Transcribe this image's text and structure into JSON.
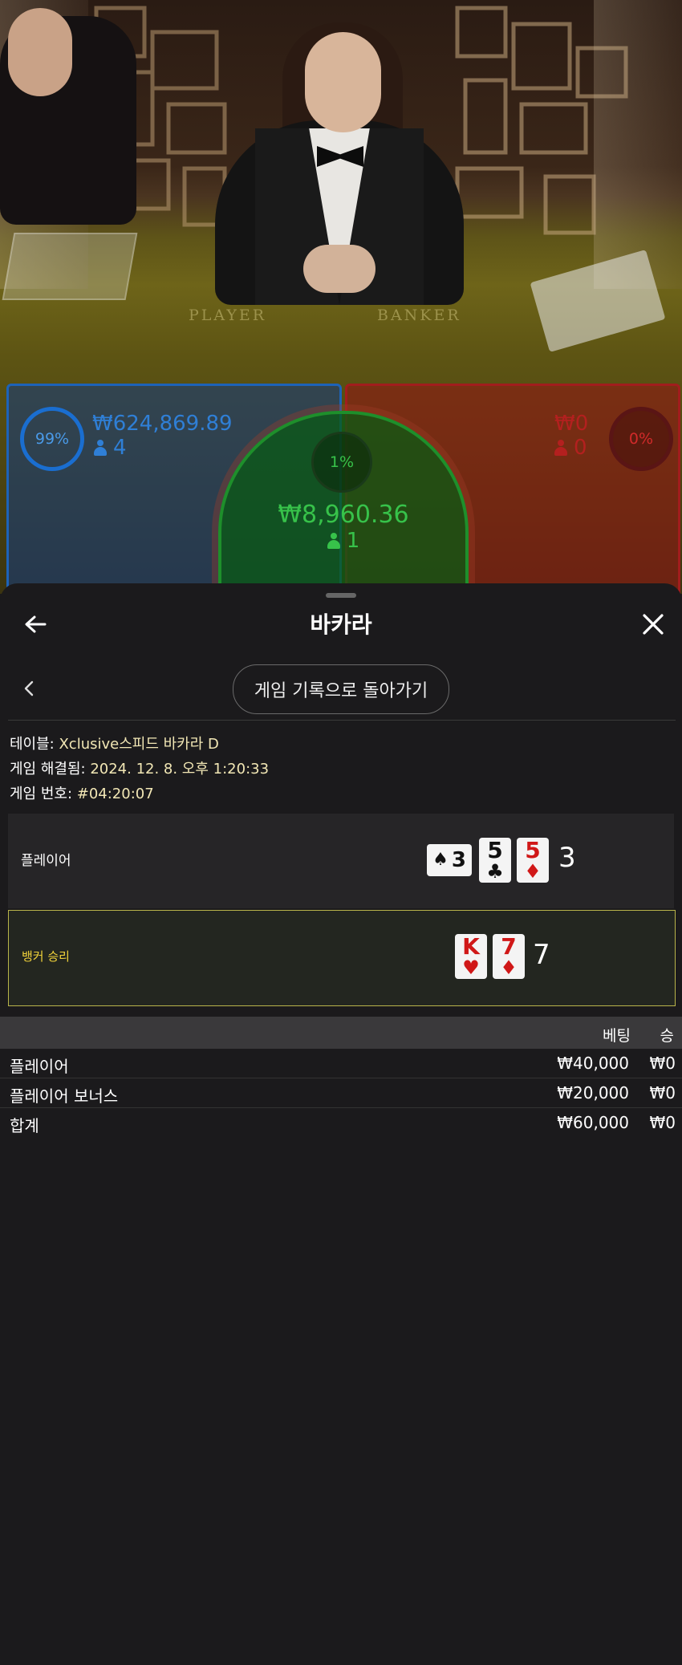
{
  "video": {
    "felt_player": "PLAYER",
    "felt_banker": "BANKER",
    "player_bet": {
      "percent": "99%",
      "amount": "₩624,869.89",
      "count": "4"
    },
    "tie_bet": {
      "percent": "1%",
      "amount": "₩8,960.36",
      "count": "1"
    },
    "banker_bet": {
      "percent": "0%",
      "amount": "₩0",
      "count": "0"
    }
  },
  "sheet": {
    "title": "바카라",
    "back_to_history": "게임 기록으로 돌아가기",
    "table_label": "테이블: ",
    "table_value": "Xclusive스피드 바카라 D",
    "resolved_label": "게임 해결됨: ",
    "resolved_value": "2024. 12. 8. 오후 1:20:33",
    "game_no_label": "게임 번호: ",
    "game_no_value": "#04:20:07"
  },
  "round": {
    "player": {
      "label": "플레이어",
      "score": "3",
      "cards": [
        {
          "rank": "3",
          "suit": "♠",
          "color": "black",
          "orientation": "horizontal"
        },
        {
          "rank": "5",
          "suit": "♣",
          "color": "black"
        },
        {
          "rank": "5",
          "suit": "♦",
          "color": "red"
        }
      ]
    },
    "banker": {
      "label": "뱅커 승리",
      "score": "7",
      "cards": [
        {
          "rank": "K",
          "suit": "♥",
          "color": "red"
        },
        {
          "rank": "7",
          "suit": "♦",
          "color": "red"
        }
      ]
    }
  },
  "bets": {
    "col_bet": "베팅",
    "col_win": "승",
    "rows": [
      {
        "name": "플레이어",
        "bet": "₩40,000",
        "win": "₩0"
      },
      {
        "name": "플레이어 보너스",
        "bet": "₩20,000",
        "win": "₩0"
      }
    ],
    "total": {
      "name": "합계",
      "bet": "₩60,000",
      "win": "₩0"
    }
  },
  "colors": {
    "player_blue": "#1d63b8",
    "banker_red": "#a11d1d",
    "tie_green": "#1e8f2b",
    "winner_border": "#b9b44a",
    "winner_label": "#f0d23a",
    "sheet_bg": "#1b1a1c"
  }
}
